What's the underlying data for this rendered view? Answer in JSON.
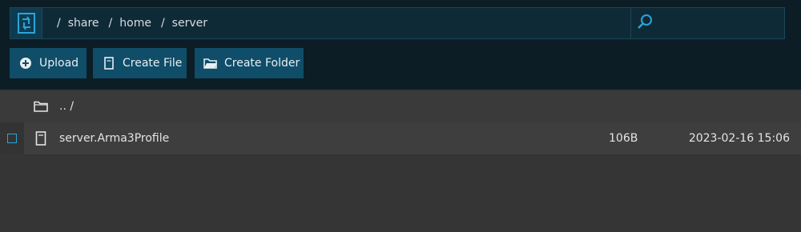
{
  "header": {
    "breadcrumbs": [
      {
        "sep": "/",
        "label": "share"
      },
      {
        "sep": "/",
        "label": "home"
      },
      {
        "sep": "/",
        "label": "server"
      }
    ],
    "search_value": "",
    "icons": {
      "logo": "refresh-logo-icon",
      "search": "search-icon"
    }
  },
  "toolbar": {
    "upload_label": "Upload",
    "create_file_label": "Create File",
    "create_folder_label": "Create Folder"
  },
  "files": {
    "parent": {
      "name": ".. /",
      "icon": "folder-icon"
    },
    "items": [
      {
        "name": "server.Arma3Profile",
        "size": "106B",
        "modified": "2023-02-16 15:06",
        "icon": "file-icon",
        "checked": false
      }
    ]
  },
  "colors": {
    "accent": "#2ba5d9",
    "button_bg": "#0f4d69",
    "header_bg": "#0c1d26",
    "list_bg": "#353535"
  }
}
